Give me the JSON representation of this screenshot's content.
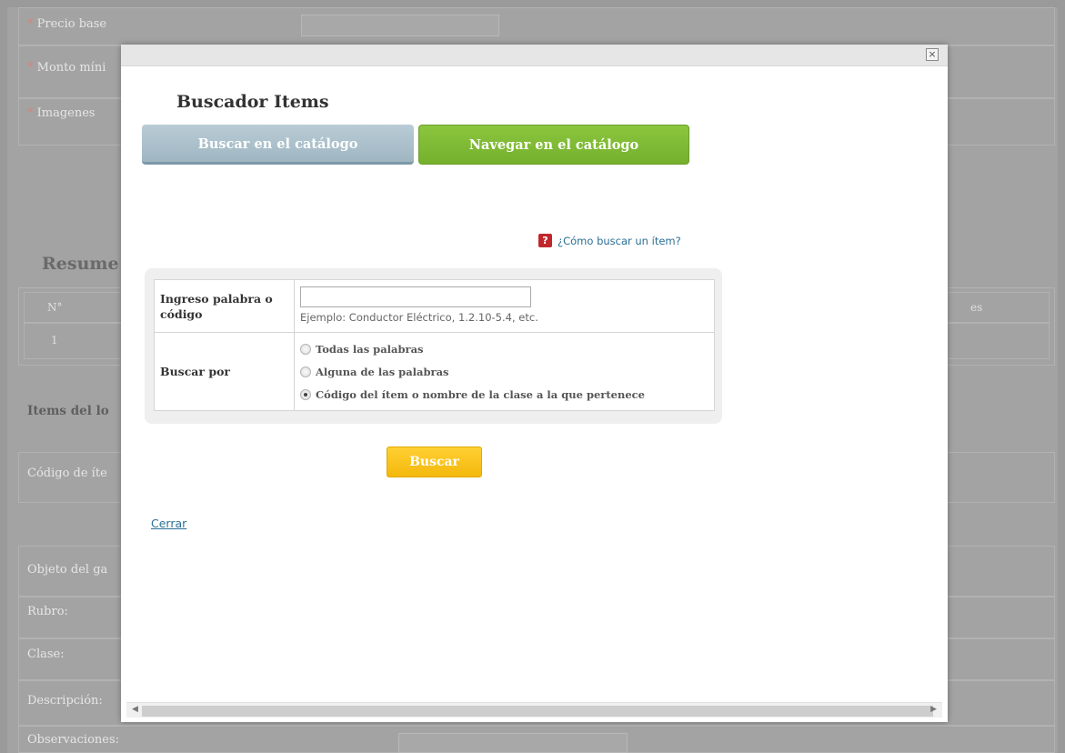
{
  "background": {
    "fields": {
      "precio_base": "Precio base",
      "monto_minimo": "Monto míni",
      "imagenes": "Imagenes"
    },
    "resumen_title": "Resume",
    "resumen_table": {
      "col_n": "N°",
      "row_1": "1",
      "trailing_col": "es"
    },
    "items_title": "Items del lo",
    "codigo_label": "Código de íte",
    "objeto_label": "Objeto del ga",
    "rubro_label": "Rubro:",
    "clase_label": "Clase:",
    "descripcion_label": "Descripción:",
    "observaciones_label": "Observaciones:"
  },
  "modal": {
    "close_icon": "x-icon",
    "title": "Buscador Items",
    "tabs": {
      "search": "Buscar en el catálogo",
      "browse": "Navegar en el catálogo"
    },
    "help": {
      "icon": "question-icon",
      "text": "¿Cómo buscar un ítem?"
    },
    "form": {
      "keyword_label": "Ingreso palabra o código",
      "keyword_value": "",
      "keyword_hint": "Ejemplo: Conductor Eléctrico, 1.2.10-5.4, etc.",
      "search_by_label": "Buscar por",
      "options": [
        {
          "label": "Todas las palabras",
          "checked": false
        },
        {
          "label": "Alguna de las palabras",
          "checked": false
        },
        {
          "label": "Código del ítem o nombre de la clase a la que pertenece",
          "checked": true
        }
      ]
    },
    "search_button": "Buscar",
    "close_link": "Cerrar"
  },
  "colors": {
    "tab_search": "#a9bfcb",
    "tab_browse": "#7fba35",
    "search_button": "#f7c21c",
    "link": "#2a6f95",
    "help_icon": "#c0262c"
  }
}
